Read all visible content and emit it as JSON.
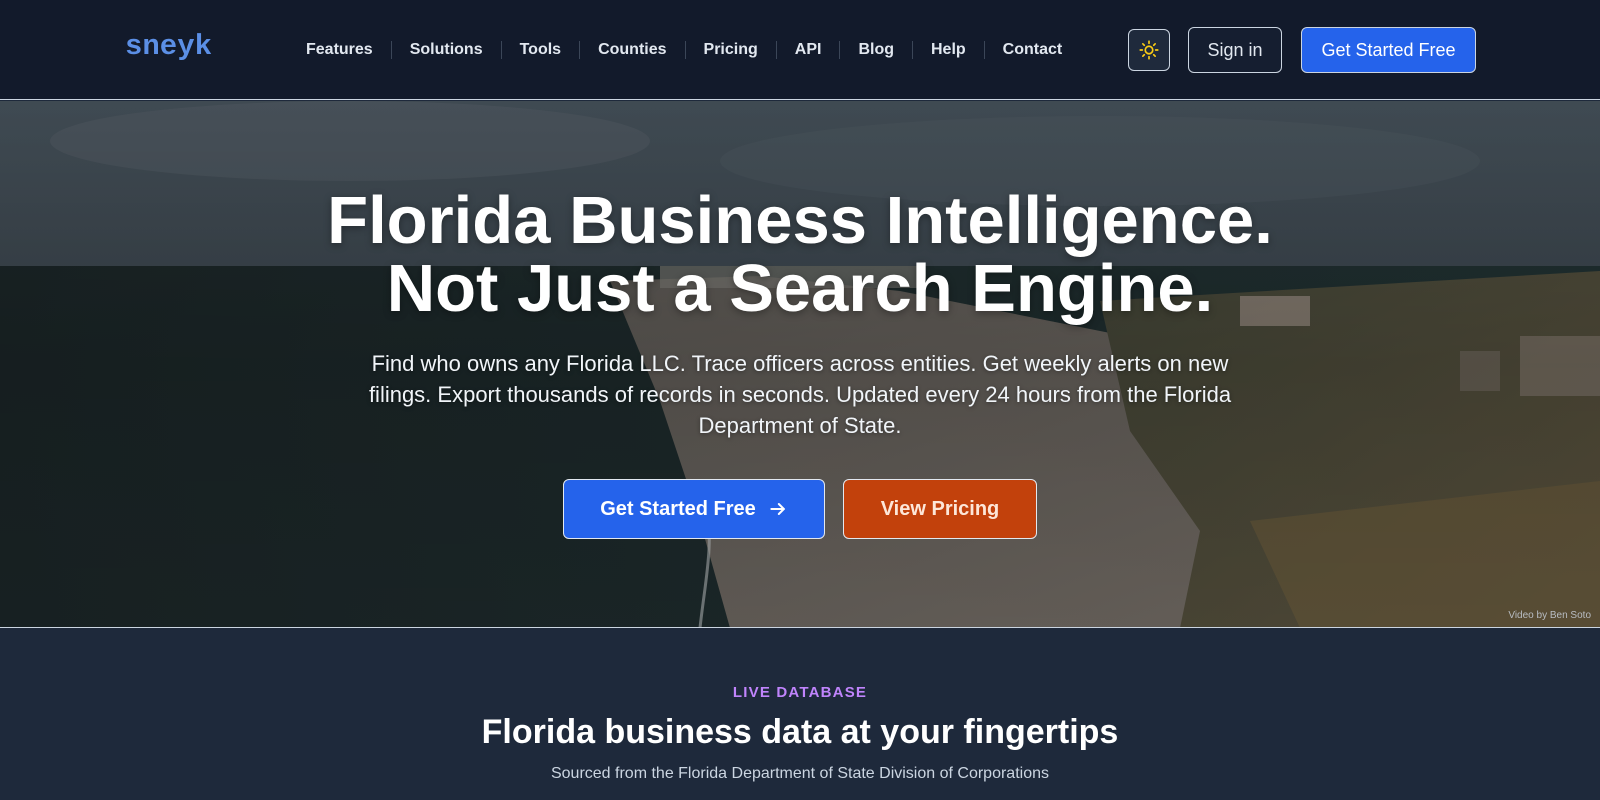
{
  "brand": {
    "logo_text": "sneyk",
    "logo_color": "#5b8fe6"
  },
  "nav": {
    "items": [
      {
        "label": "Features"
      },
      {
        "label": "Solutions"
      },
      {
        "label": "Tools"
      },
      {
        "label": "Counties"
      },
      {
        "label": "Pricing"
      },
      {
        "label": "API"
      },
      {
        "label": "Blog"
      },
      {
        "label": "Help"
      },
      {
        "label": "Contact"
      }
    ]
  },
  "header": {
    "theme_icon": "sun-icon",
    "signin_label": "Sign in",
    "cta_label": "Get Started Free"
  },
  "hero": {
    "title_line1": "Florida Business Intelligence.",
    "title_line2": "Not Just a Search Engine.",
    "subtitle": "Find who owns any Florida LLC. Trace officers across entities. Get weekly alerts on new filings. Export thousands of records in seconds. Updated every 24 hours from the Florida Department of State.",
    "primary_cta": "Get Started Free",
    "primary_cta_icon": "arrow-right-icon",
    "secondary_cta": "View Pricing",
    "video_credit": "Video by Ben Soto"
  },
  "database": {
    "eyebrow": "LIVE DATABASE",
    "title": "Florida business data at your fingertips",
    "subtitle": "Sourced from the Florida Department of State Division of Corporations"
  },
  "colors": {
    "primary_blue": "#2563eb",
    "accent_orange": "#c2410c",
    "eyebrow_purple": "#c084fc",
    "header_bg": "#121a2b",
    "section_bg": "#1e293b"
  }
}
